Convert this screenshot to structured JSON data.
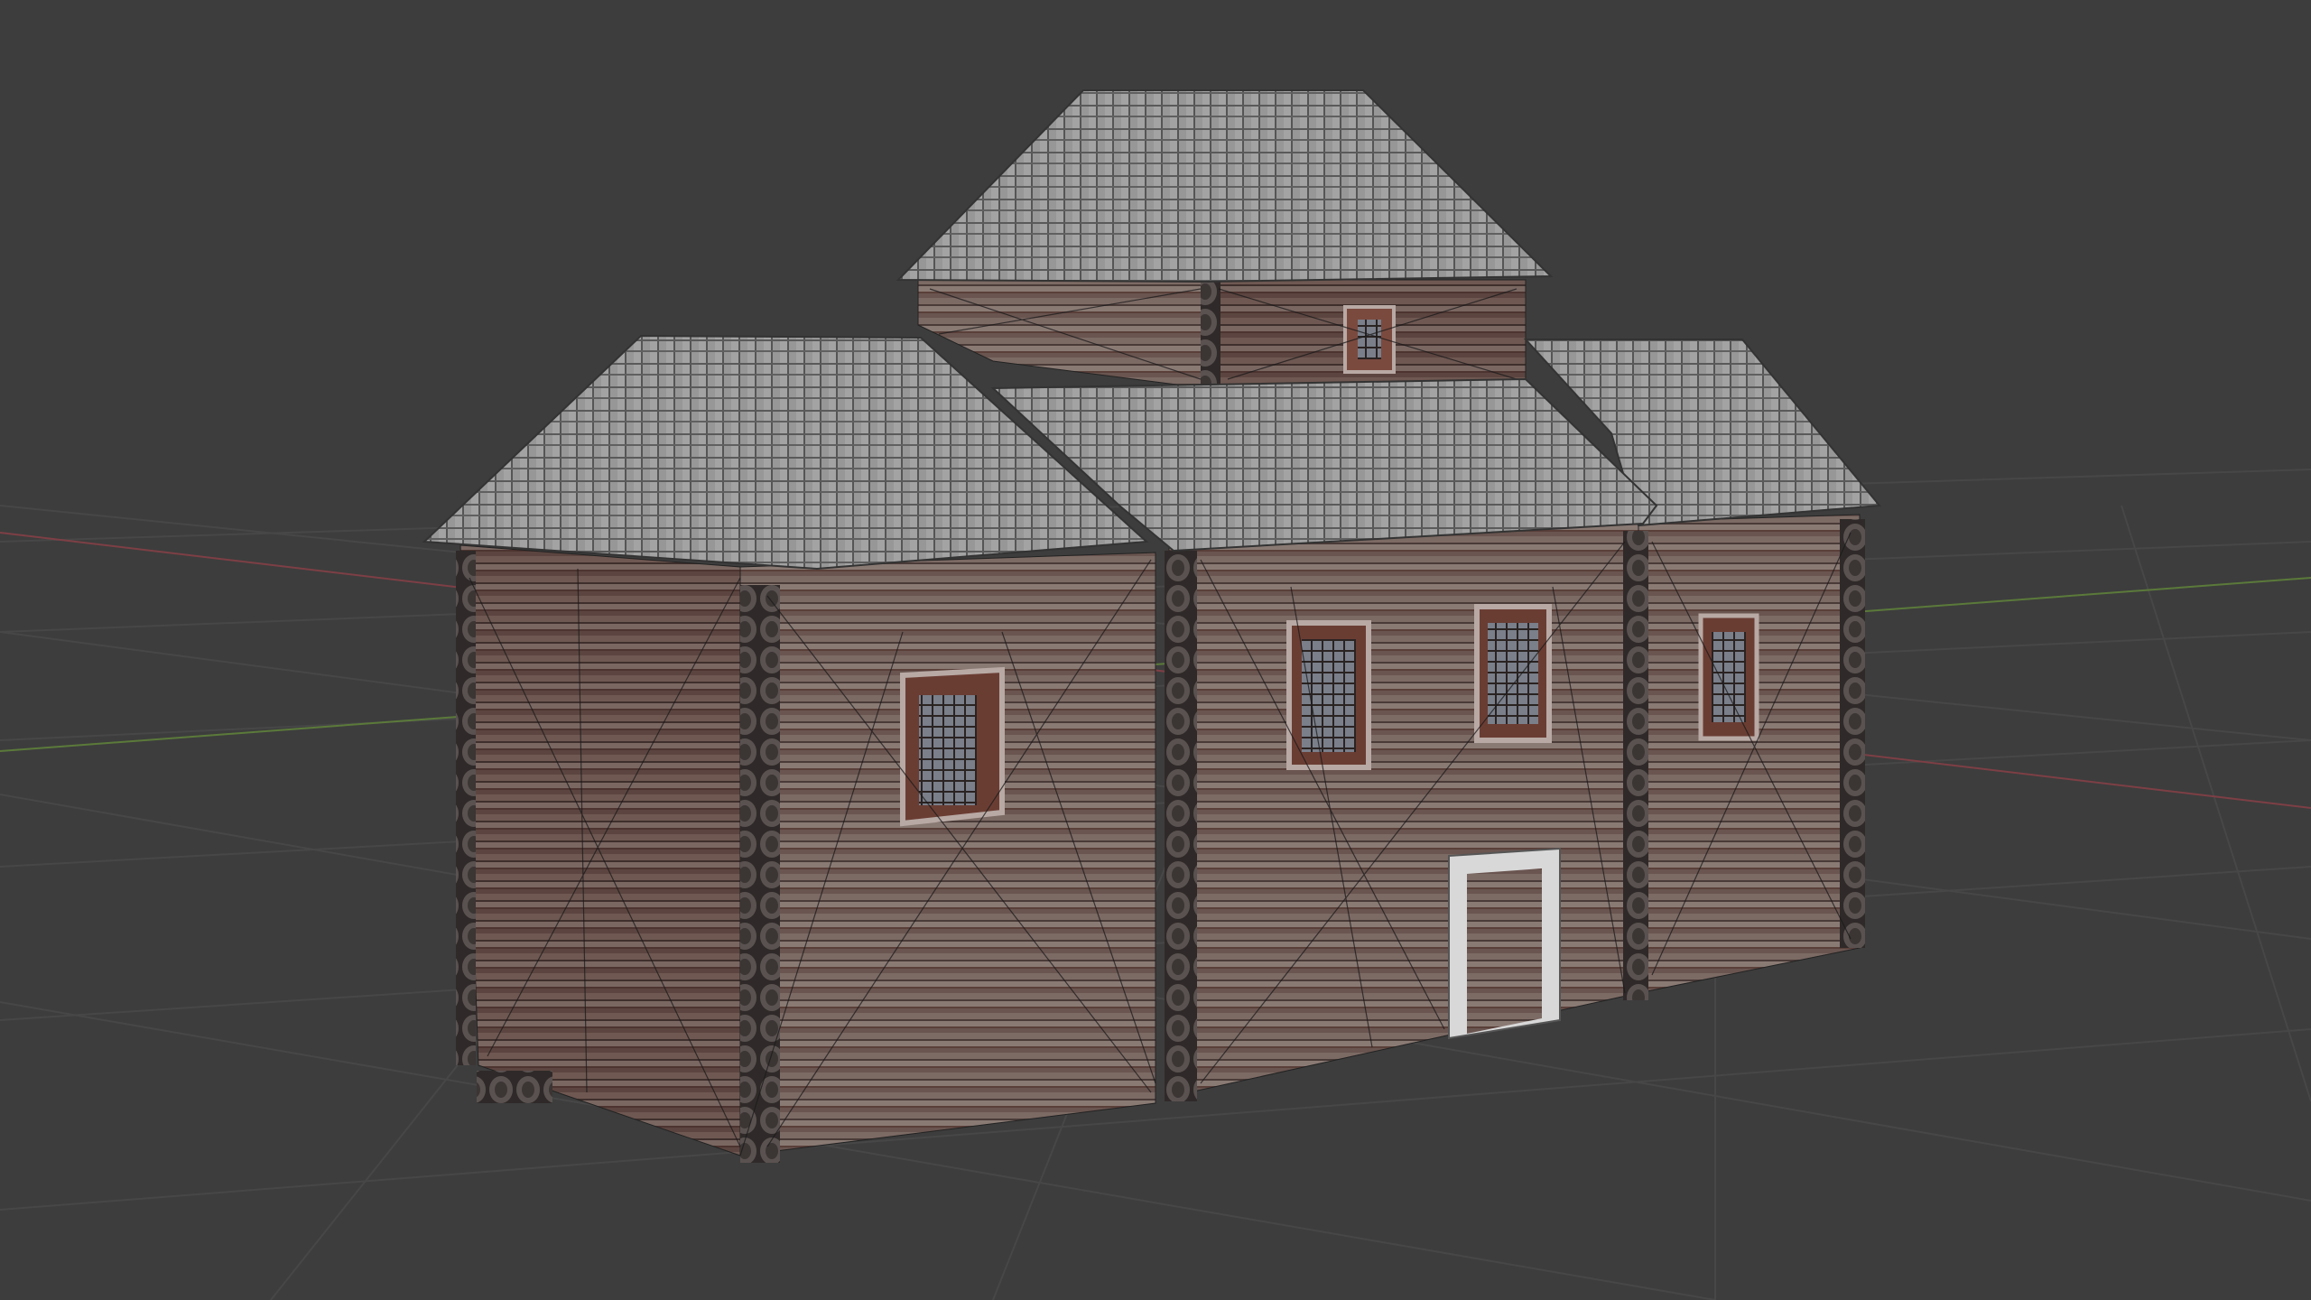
{
  "viewport": {
    "background": "#3d3d3d",
    "grid_color": "#4a4a4a",
    "x_axis_color": "#8a4048",
    "y_axis_color": "#5b7a3a"
  },
  "scene": {
    "object": "log-church-model",
    "roof_color": "#8f8f8f",
    "wall_color": "#6e5a55",
    "log_color": "#3b3534",
    "window_frame_color": "#9a8a86"
  }
}
